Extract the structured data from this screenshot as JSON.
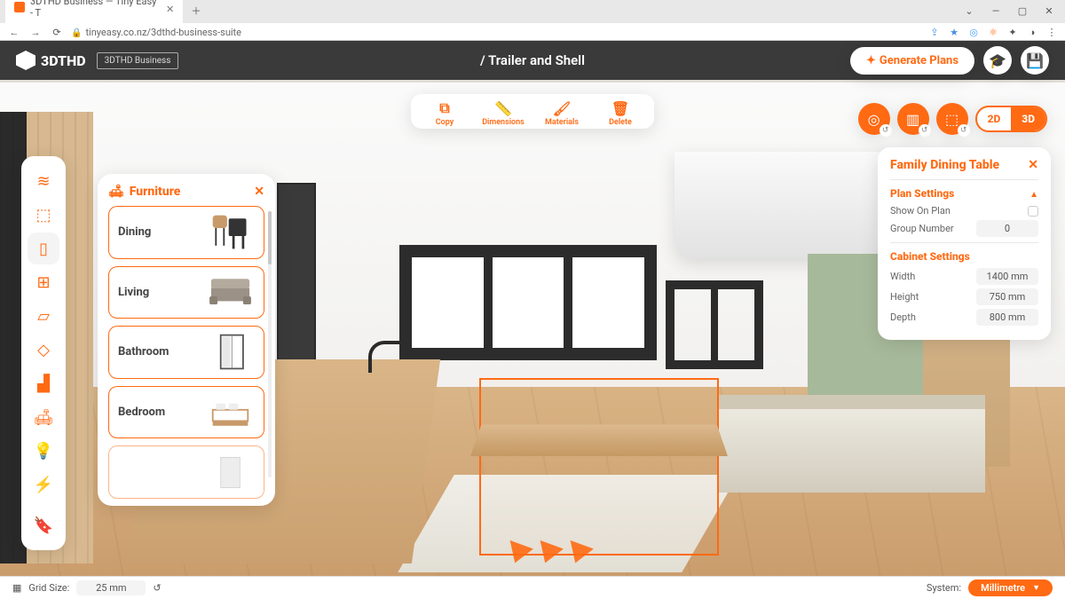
{
  "browser": {
    "tab_title": "3DTHD Business — Tiny Easy - T",
    "url": "tinyeasy.co.nz/3dthd-business-suite"
  },
  "colors": {
    "accent": "#ff6a13"
  },
  "app": {
    "logo": "3DTHD",
    "plan_badge": "3DTHD Business",
    "breadcrumb": "/ Trailer and Shell",
    "generate_label": "Generate Plans"
  },
  "context_toolbar": [
    {
      "icon": "copy",
      "label": "Copy"
    },
    {
      "icon": "ruler",
      "label": "Dimensions"
    },
    {
      "icon": "paint",
      "label": "Materials"
    },
    {
      "icon": "trash",
      "label": "Delete"
    }
  ],
  "view_toggle": {
    "a": "2D",
    "b": "3D",
    "active": "3D"
  },
  "sidebar": [
    "layers",
    "cube",
    "door",
    "window",
    "wall",
    "floor",
    "stairs",
    "furniture",
    "lighting",
    "electrical",
    "bookmark"
  ],
  "furniture_panel": {
    "title": "Furniture",
    "items": [
      "Dining",
      "Living",
      "Bathroom",
      "Bedroom"
    ]
  },
  "properties": {
    "title": "Family Dining Table",
    "plan_section": "Plan Settings",
    "show_on_plan_label": "Show On Plan",
    "group_number_label": "Group Number",
    "group_number_value": "0",
    "cabinet_section": "Cabinet Settings",
    "dims": [
      {
        "label": "Width",
        "value": "1400 mm"
      },
      {
        "label": "Height",
        "value": "750 mm"
      },
      {
        "label": "Depth",
        "value": "800 mm"
      }
    ]
  },
  "statusbar": {
    "grid_label": "Grid Size:",
    "grid_value": "25 mm",
    "system_label": "System:",
    "system_value": "Millimetre"
  }
}
